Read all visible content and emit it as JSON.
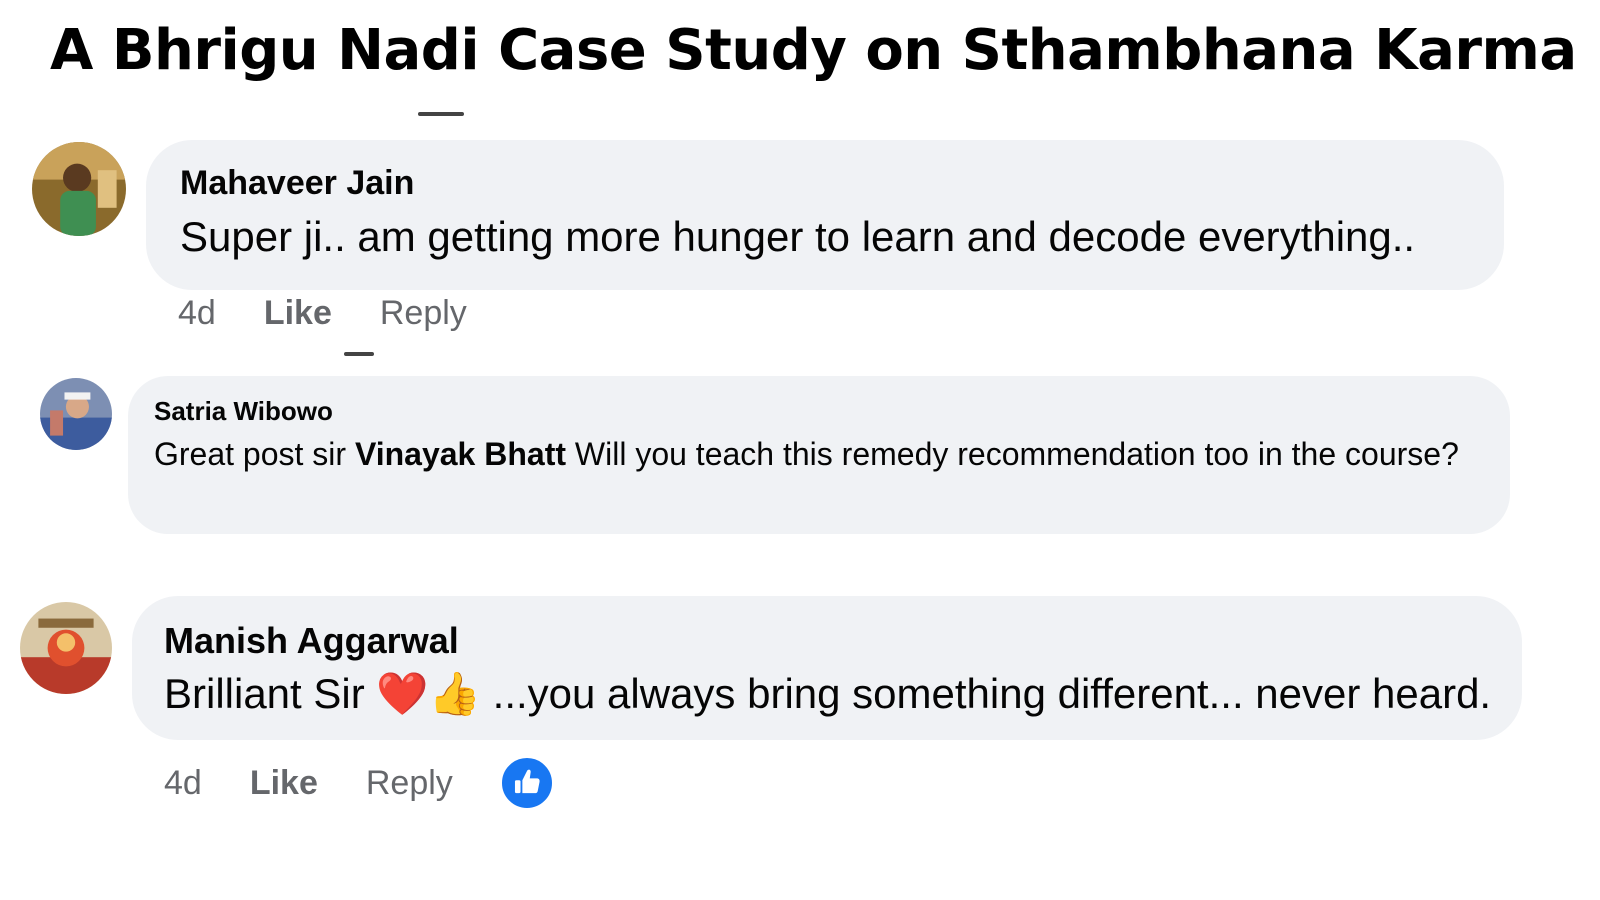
{
  "title": "A Bhrigu Nadi Case Study on Sthambhana Karma",
  "comments": [
    {
      "author": "Mahaveer Jain",
      "text": "Super ji.. am getting more hunger to learn and decode everything..",
      "timestamp": "4d",
      "like_label": "Like",
      "reply_label": "Reply"
    },
    {
      "author": "Satria Wibowo",
      "text_before": "Great post sir ",
      "mention": "Vinayak Bhatt",
      "text_after": " Will you teach this remedy recommendation too in the course?"
    },
    {
      "author": "Manish Aggarwal",
      "text_before": "Brilliant Sir ",
      "emoji_heart": "❤️",
      "emoji_thumb": "👍",
      "text_after": " ...you always bring something different... never heard.",
      "timestamp": "4d",
      "like_label": "Like",
      "reply_label": "Reply"
    }
  ],
  "colors": {
    "bubble_bg": "#f0f2f5",
    "meta_text": "#65676b",
    "like_badge": "#1877f2"
  },
  "icons": {
    "reaction": "thumbs-up-icon"
  }
}
